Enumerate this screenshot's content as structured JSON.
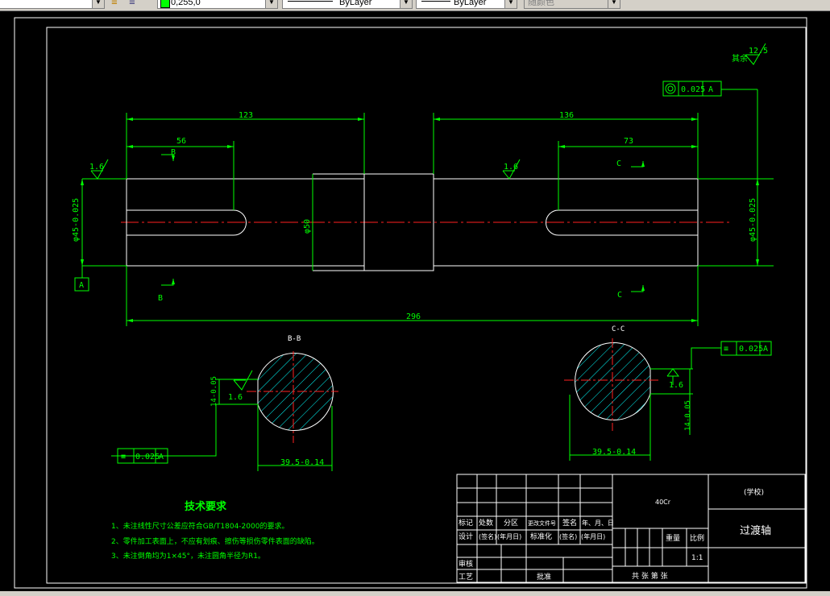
{
  "toolbar": {
    "color_value": "0,255,0",
    "linetype_value": "ByLayer",
    "lineweight_value": "ByLayer",
    "plotstyle_value": "随颜色",
    "layer_icon": "layers-icon",
    "color_swatch": "#00ff00"
  },
  "drawing": {
    "dims": {
      "d123": "123",
      "d56": "56",
      "d136": "136",
      "d73": "73",
      "d296": "296",
      "phi50": "φ50",
      "phi45_left": "φ45-0.025",
      "phi45_right": "φ45-0.025",
      "d395_left": "39.5-0.14",
      "d395_right": "39.5-0.14",
      "d14_left": "14-0.05",
      "d14_right": "14-0.05"
    },
    "roughness": {
      "r1": "1.6",
      "r2": "1.6",
      "r3": "1.6",
      "r4": "1.6",
      "rest_label": "其余",
      "rest_value": "12.5"
    },
    "tolerances": {
      "top_right": {
        "value": "0.025",
        "datum": "A"
      },
      "section_left": {
        "value": "0.025",
        "datum": "A"
      },
      "section_right": {
        "value": "0.025",
        "datum": "A"
      }
    },
    "datum_label": "A",
    "section_marks": {
      "b_top": "B",
      "b_bottom": "B",
      "c_top": "C",
      "c_bottom": "C"
    },
    "section_titles": {
      "bb": "B-B",
      "cc": "C-C"
    },
    "tech_req": {
      "title": "技术要求",
      "items": [
        "1、未注线性尺寸公差应符合GB/T1804-2000的要求。",
        "2、零件加工表面上，不应有划痕、擦伤等损伤零件表面的缺陷。",
        "3、未注倒角均为1×45°，未注圆角半径为R1。"
      ]
    },
    "title_block": {
      "material": "40Cr",
      "school": "(学校)",
      "part_name": "过渡轴",
      "row1": [
        "标记",
        "处数",
        "分区",
        "更改文件号",
        "签名",
        "年、月、日"
      ],
      "row2": [
        "设计",
        "(签名)",
        "(年月日)",
        "标准化",
        "(签名)",
        "(年月日)"
      ],
      "review": "审核",
      "process": "工艺",
      "approve": "批准",
      "weight": "重量",
      "scale": "比例",
      "scale_value": "1:1",
      "sheets": "共    张    第    张"
    }
  }
}
